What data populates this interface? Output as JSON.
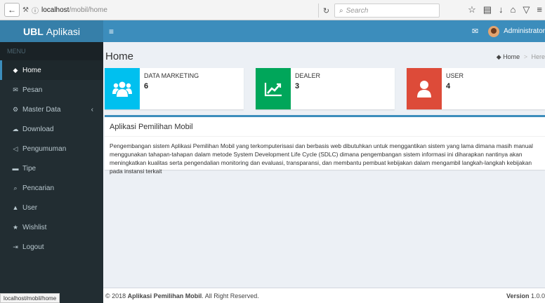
{
  "browser": {
    "back_icon": "back-arrow-icon",
    "url_host": "localhost",
    "url_path": "/mobil/home",
    "reload_icon": "reload-icon",
    "search_placeholder": "Search"
  },
  "sidebar": {
    "brand_bold": "UBL",
    "brand_rest": "Aplikasi",
    "menu_header": "MENU",
    "items": [
      {
        "label": "Home",
        "icon": "dashboard-icon"
      },
      {
        "label": "Pesan",
        "icon": "envelope-icon"
      },
      {
        "label": "Master Data",
        "icon": "cogs-icon"
      },
      {
        "label": "Download",
        "icon": "cloud-download-icon"
      },
      {
        "label": "Pengumuman",
        "icon": "bullhorn-icon"
      },
      {
        "label": "Tipe",
        "icon": "car-icon"
      },
      {
        "label": "Pencarian",
        "icon": "search-icon"
      },
      {
        "label": "User",
        "icon": "user-icon"
      },
      {
        "label": "Wishlist",
        "icon": "star-icon"
      },
      {
        "label": "Logout",
        "icon": "sign-out-icon"
      }
    ]
  },
  "navbar": {
    "user_name": "Administrator"
  },
  "content": {
    "title": "Home",
    "breadcrumb_home": "Home",
    "breadcrumb_current": "Here"
  },
  "info_boxes": [
    {
      "label": "DATA MARKETING",
      "value": "6",
      "color": "#00c0ef",
      "icon": "users-icon"
    },
    {
      "label": "DEALER",
      "value": "3",
      "color": "#00a65a",
      "icon": "line-chart-icon"
    },
    {
      "label": "USER",
      "value": "4",
      "color": "#dd4b39",
      "icon": "user-icon"
    }
  ],
  "box": {
    "title": "Aplikasi Pemilihan Mobil",
    "body": "Pengembangan sistem Aplikasi Pemilihan Mobil yang terkomputerisasi dan berbasis web dibutuhkan untuk menggantikan sistem yang lama dimana masih manual menggunakan tahapan-tahapan dalam metode System Development Life Cycle (SDLC) dimana pengembangan sistem informasi ini diharapkan nantinya akan meningkatkan kualitas serta pengendalian monitoring dan evaluasi, transparansi, dan membantu pembuat kebijakan dalam mengambil langkah-langkah kebijakan pada instansi terkait"
  },
  "footer": {
    "prefix": "© 2018",
    "app_name": "Aplikasi Pemilihan Mobil",
    "suffix": ". All Right Reserved.",
    "version_label": "Version",
    "version": "1.0.0"
  },
  "status_bar": {
    "url": "localhost/mobil/home"
  },
  "colors": {
    "sidebar_bg": "#222d32",
    "navbar": "#3c8dbc",
    "brand": "#367fa9"
  }
}
